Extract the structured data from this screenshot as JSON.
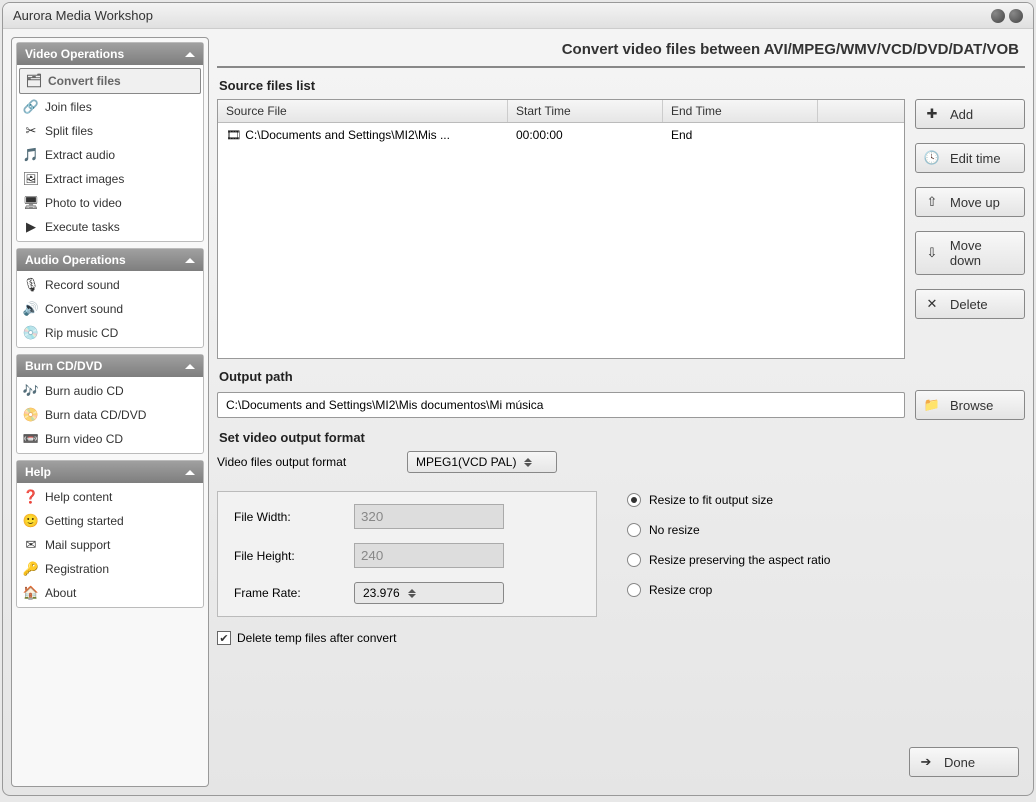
{
  "window": {
    "title": "Aurora Media Workshop"
  },
  "sidebar": {
    "groups": [
      {
        "title": "Video Operations",
        "items": [
          {
            "label": "Convert files",
            "icon": "🗂",
            "active": true
          },
          {
            "label": "Join files",
            "icon": "🔗"
          },
          {
            "label": "Split files",
            "icon": "✂"
          },
          {
            "label": "Extract audio",
            "icon": "🎵"
          },
          {
            "label": "Extract images",
            "icon": "🖼"
          },
          {
            "label": "Photo to video",
            "icon": "🖥"
          },
          {
            "label": "Execute tasks",
            "icon": "▶"
          }
        ]
      },
      {
        "title": "Audio Operations",
        "items": [
          {
            "label": "Record sound",
            "icon": "🎙"
          },
          {
            "label": "Convert sound",
            "icon": "🔊"
          },
          {
            "label": "Rip music CD",
            "icon": "💿"
          }
        ]
      },
      {
        "title": "Burn CD/DVD",
        "items": [
          {
            "label": "Burn audio CD",
            "icon": "🎶"
          },
          {
            "label": "Burn data CD/DVD",
            "icon": "📀"
          },
          {
            "label": "Burn video CD",
            "icon": "📼"
          }
        ]
      },
      {
        "title": "Help",
        "items": [
          {
            "label": "Help content",
            "icon": "❓"
          },
          {
            "label": "Getting started",
            "icon": "🙂"
          },
          {
            "label": "Mail support",
            "icon": "✉"
          },
          {
            "label": "Registration",
            "icon": "🔑"
          },
          {
            "label": "About",
            "icon": "🏠"
          }
        ]
      }
    ]
  },
  "main": {
    "title": "Convert video files between AVI/MPEG/WMV/VCD/DVD/DAT/VOB",
    "source_label": "Source files list",
    "columns": {
      "file": "Source File",
      "start": "Start Time",
      "end": "End Time"
    },
    "rows": [
      {
        "file": "C:\\Documents and Settings\\MI2\\Mis ...",
        "start": "00:00:00",
        "end": "End"
      }
    ],
    "buttons": {
      "add": "Add",
      "edit_time": "Edit time",
      "move_up": "Move up",
      "move_down": "Move down",
      "delete": "Delete",
      "browse": "Browse",
      "done": "Done"
    },
    "output": {
      "label": "Output path",
      "value": "C:\\Documents and Settings\\MI2\\Mis documentos\\Mi música"
    },
    "format": {
      "label": "Set video output format",
      "output_format_label": "Video files output format",
      "output_format_value": "MPEG1(VCD PAL)",
      "file_width_label": "File Width:",
      "file_width_value": "320",
      "file_height_label": "File Height:",
      "file_height_value": "240",
      "frame_rate_label": "Frame Rate:",
      "frame_rate_value": "23.976"
    },
    "resize": {
      "fit": "Resize to fit output size",
      "no": "No resize",
      "preserve": "Resize preserving the aspect ratio",
      "crop": "Resize crop",
      "selected": "fit"
    },
    "delete_temp_label": "Delete temp files after convert",
    "delete_temp_checked": true
  }
}
